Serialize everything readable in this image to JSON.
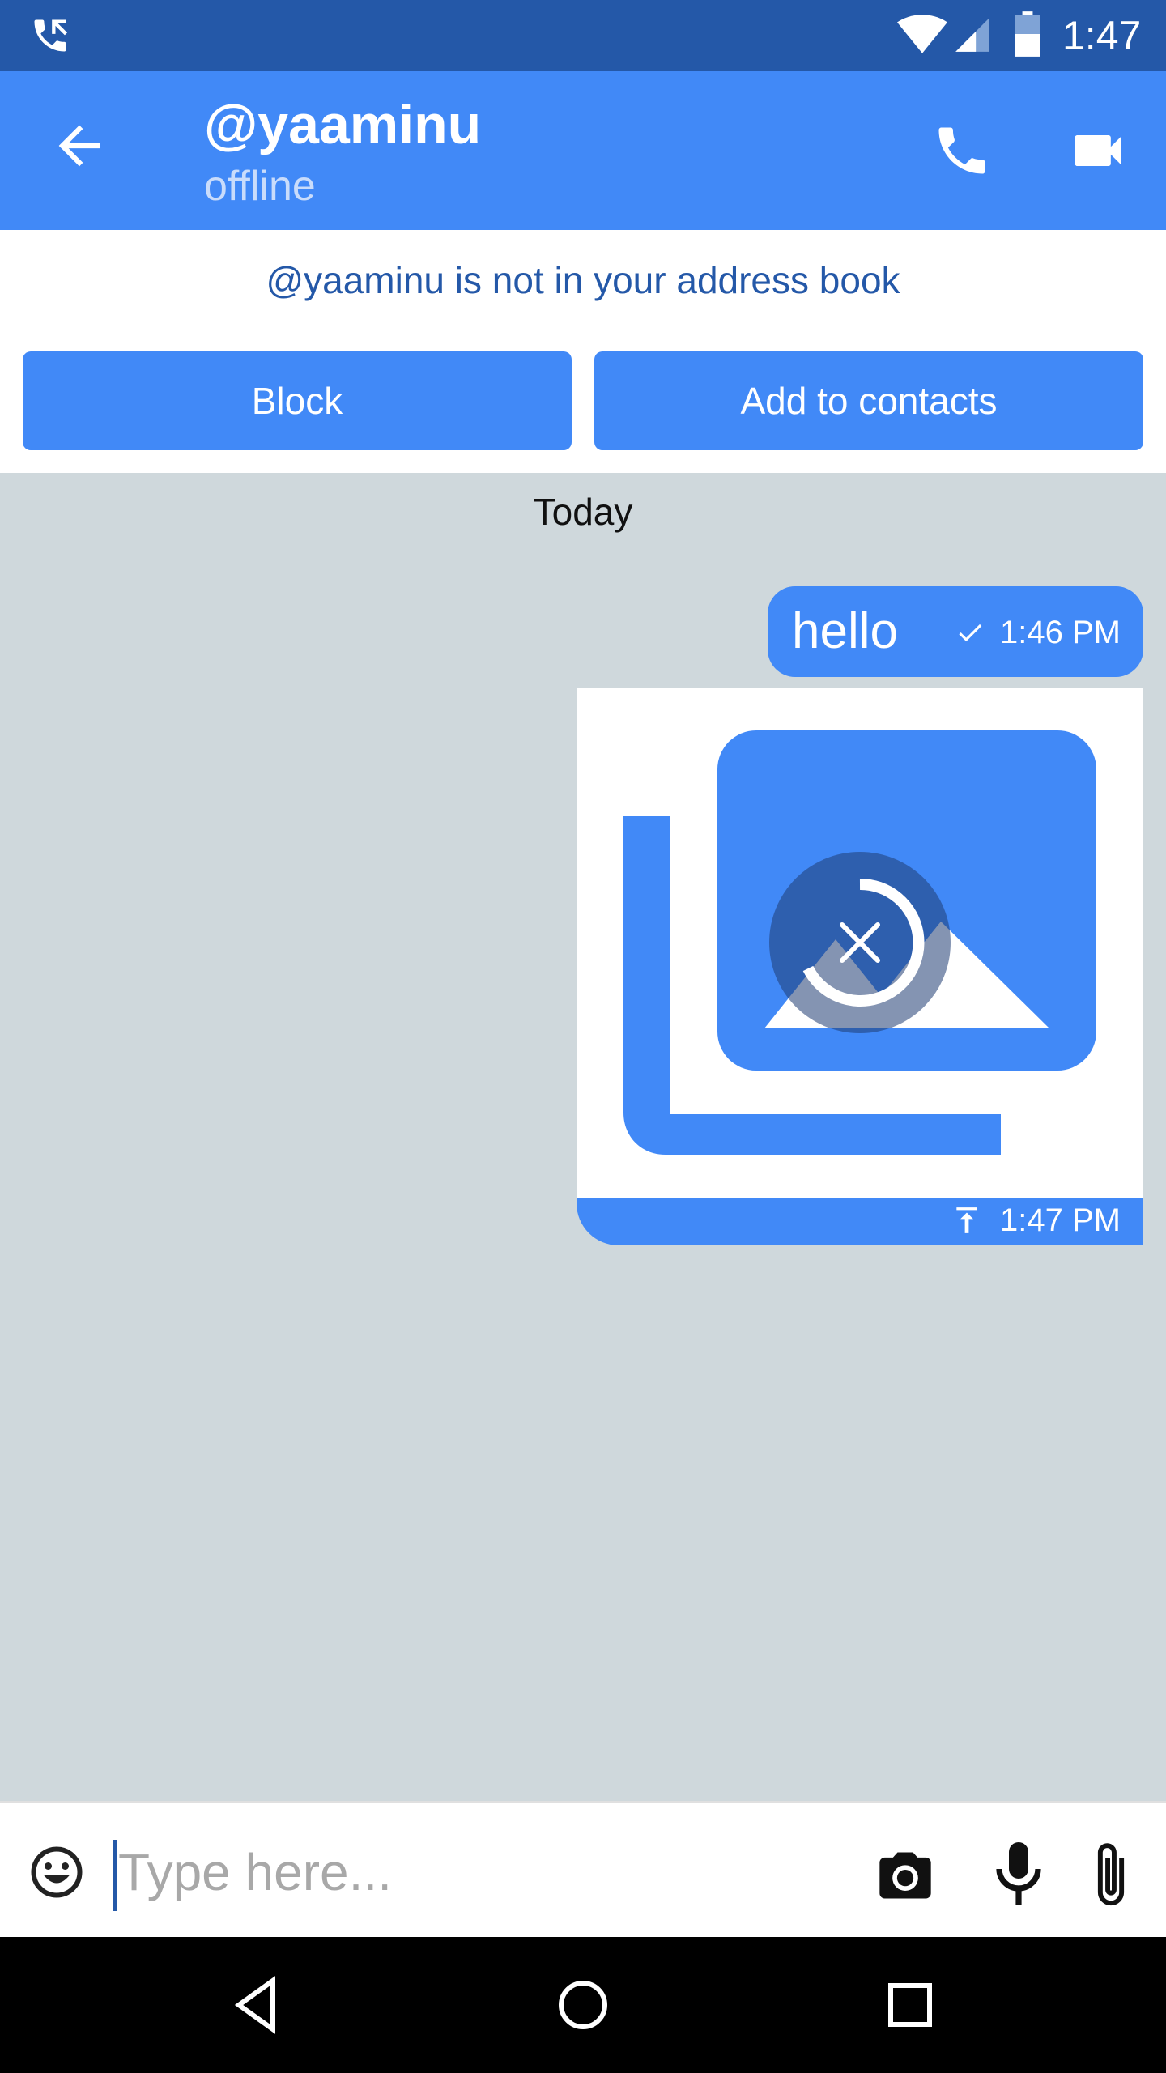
{
  "status_bar": {
    "time": "1:47",
    "icons": [
      "phone-call-icon",
      "wifi-icon",
      "cell-signal-icon",
      "battery-icon"
    ]
  },
  "app_bar": {
    "title": "@yaaminu",
    "subtitle": "offline",
    "icons": [
      "back-arrow-icon",
      "phone-icon",
      "video-camera-icon"
    ]
  },
  "notice": {
    "message": "@yaaminu is not in your address book",
    "block_label": "Block",
    "add_label": "Add to contacts"
  },
  "conversation": {
    "date_separator": "Today",
    "messages": [
      {
        "type": "text",
        "body": "hello",
        "status_icon": "check-icon",
        "time": "1:46 PM"
      },
      {
        "type": "image",
        "status_icon": "upload-icon",
        "time": "1:47 PM",
        "icon": "image-placeholder-icon",
        "overlay_icon": "cancel-upload-icon"
      }
    ]
  },
  "composer": {
    "placeholder": "Type here...",
    "value": "",
    "icons": [
      "emoji-icon",
      "camera-icon",
      "microphone-icon",
      "attach-icon"
    ]
  },
  "nav_bar": {
    "icons": [
      "nav-back-icon",
      "nav-home-icon",
      "nav-recents-icon"
    ]
  },
  "colors": {
    "status_bar": "#2458a8",
    "app_bar": "#4189f7",
    "accent": "#4189f7",
    "chat_background": "#cfd8dc",
    "notice_text": "#2458a8"
  }
}
